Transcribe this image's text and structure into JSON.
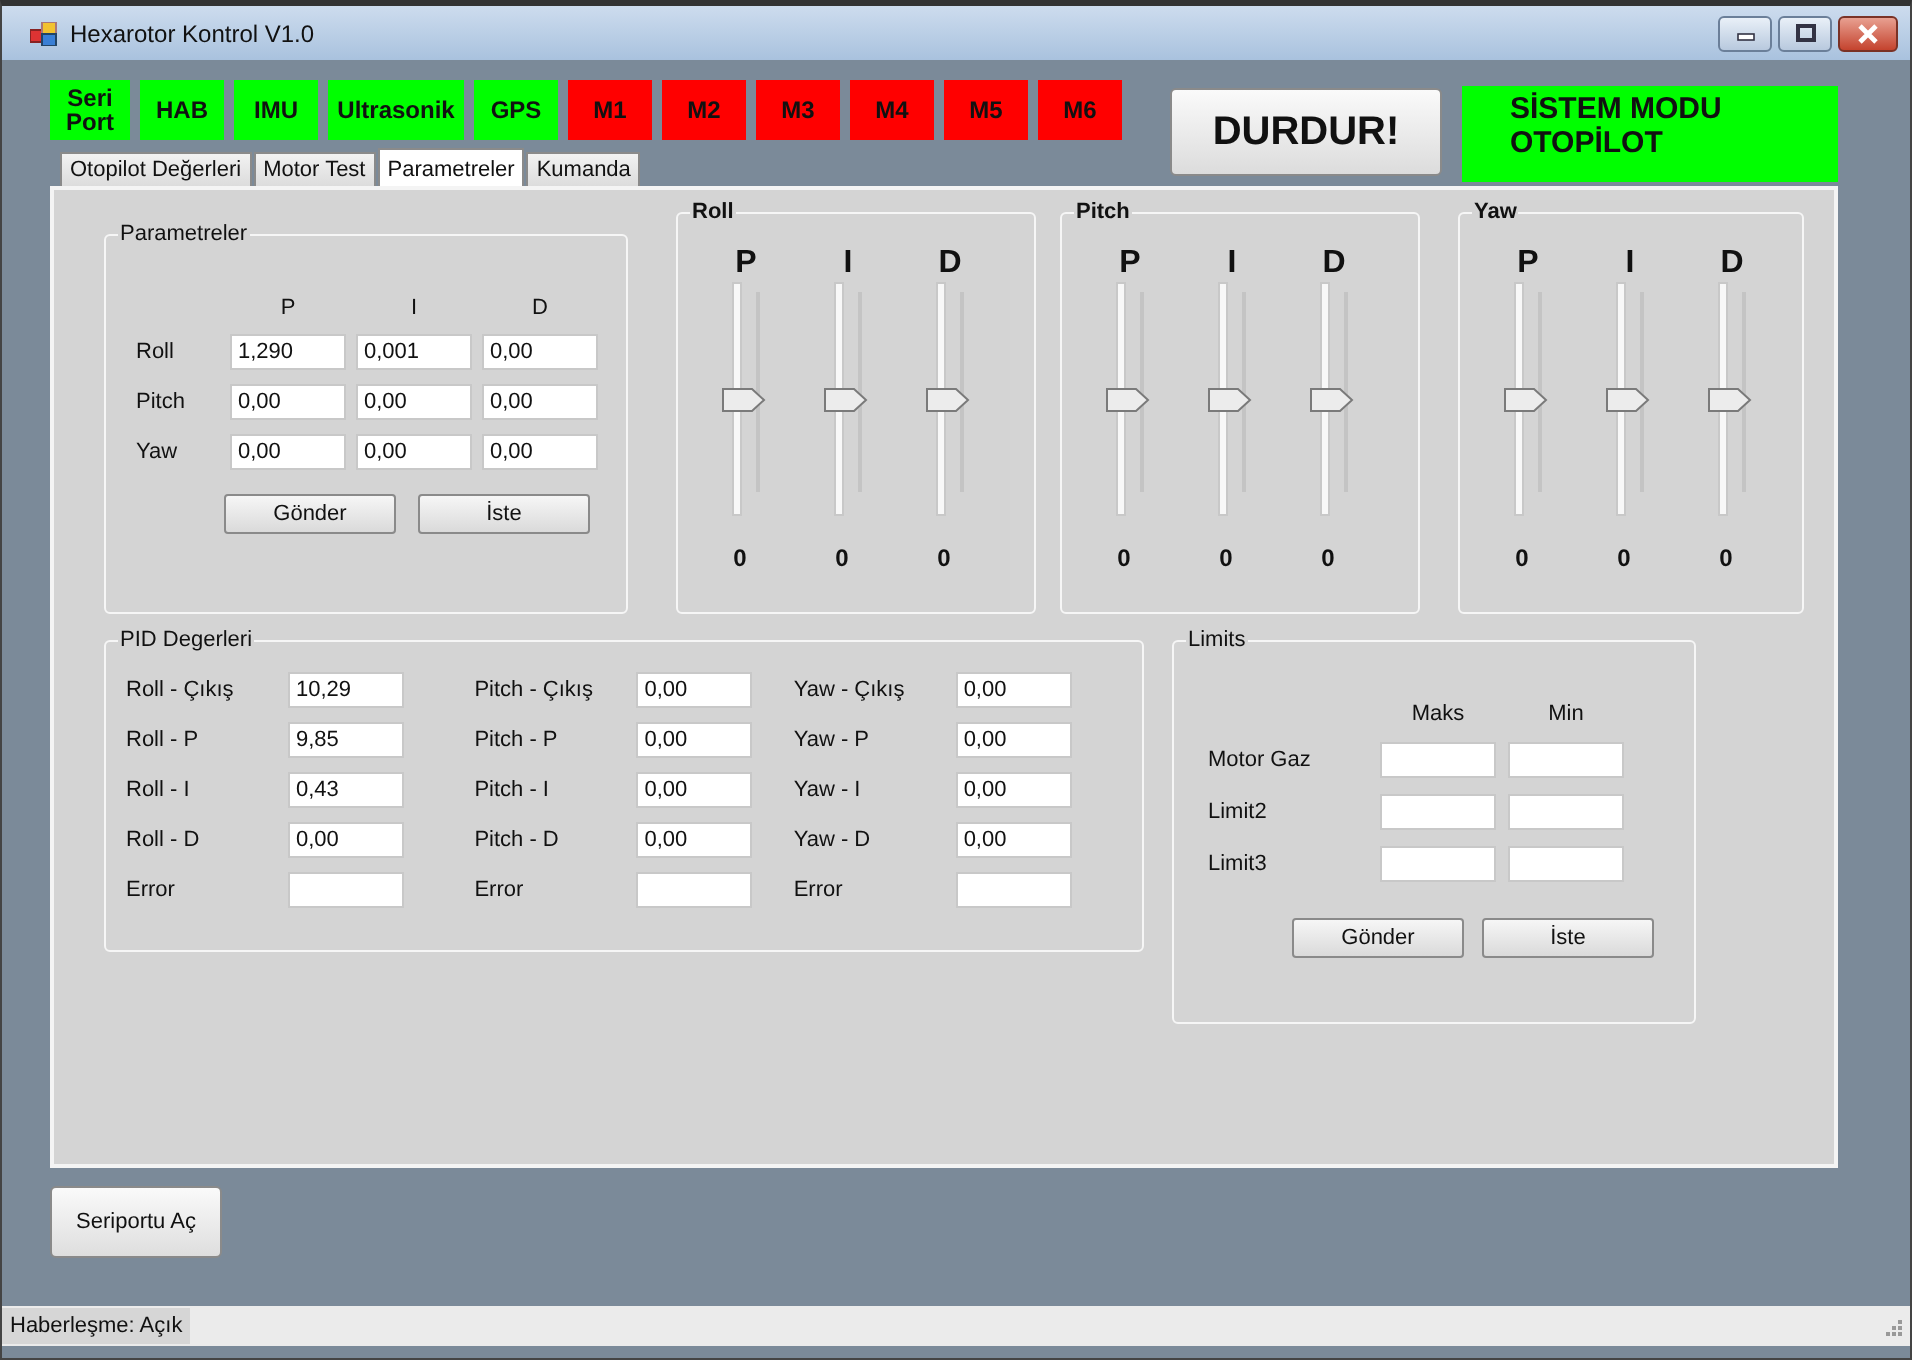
{
  "window": {
    "title": "Hexarotor Kontrol V1.0"
  },
  "indicators": [
    {
      "label": "Seri Port",
      "on": true
    },
    {
      "label": "HAB",
      "on": true
    },
    {
      "label": "IMU",
      "on": true
    },
    {
      "label": "Ultrasonik",
      "on": true
    },
    {
      "label": "GPS",
      "on": true
    },
    {
      "label": "M1",
      "on": false
    },
    {
      "label": "M2",
      "on": false
    },
    {
      "label": "M3",
      "on": false
    },
    {
      "label": "M4",
      "on": false
    },
    {
      "label": "M5",
      "on": false
    },
    {
      "label": "M6",
      "on": false
    }
  ],
  "stop_button": "DURDUR!",
  "mode_panel": "SİSTEM MODU OTOPİLOT",
  "tabs": [
    {
      "label": "Otopilot Değerleri",
      "selected": false
    },
    {
      "label": "Motor Test",
      "selected": false
    },
    {
      "label": "Parametreler",
      "selected": true
    },
    {
      "label": "Kumanda",
      "selected": false
    }
  ],
  "parameters": {
    "title": "Parametreler",
    "columns": [
      "P",
      "I",
      "D"
    ],
    "rows": [
      {
        "label": "Roll",
        "values": [
          "1,290",
          "0,001",
          "0,00"
        ]
      },
      {
        "label": "Pitch",
        "values": [
          "0,00",
          "0,00",
          "0,00"
        ]
      },
      {
        "label": "Yaw",
        "values": [
          "0,00",
          "0,00",
          "0,00"
        ]
      }
    ],
    "buttons": [
      "Gönder",
      "İste"
    ]
  },
  "slider_groups": [
    {
      "title": "Roll",
      "sliders": [
        {
          "label": "P",
          "level": 0.5,
          "reading": "0"
        },
        {
          "label": "I",
          "level": 0.5,
          "reading": "0"
        },
        {
          "label": "D",
          "level": 0.5,
          "reading": "0"
        }
      ]
    },
    {
      "title": "Pitch",
      "sliders": [
        {
          "label": "P",
          "level": 0.5,
          "reading": "0"
        },
        {
          "label": "I",
          "level": 0.5,
          "reading": "0"
        },
        {
          "label": "D",
          "level": 0.5,
          "reading": "0"
        }
      ]
    },
    {
      "title": "Yaw",
      "sliders": [
        {
          "label": "P",
          "level": 0.5,
          "reading": "0"
        },
        {
          "label": "I",
          "level": 0.5,
          "reading": "0"
        },
        {
          "label": "D",
          "level": 0.5,
          "reading": "0"
        }
      ]
    }
  ],
  "pid_values": {
    "title": "PID Degerleri",
    "columns": [
      {
        "rows": [
          {
            "label": "Roll - Çıkış",
            "value": "10,29"
          },
          {
            "label": "Roll - P",
            "value": "9,85"
          },
          {
            "label": "Roll - I",
            "value": "0,43"
          },
          {
            "label": "Roll - D",
            "value": "0,00"
          },
          {
            "label": "Error"
          }
        ]
      },
      {
        "rows": [
          {
            "label": "Pitch - Çıkış",
            "value": "0,00"
          },
          {
            "label": "Pitch - P",
            "value": "0,00"
          },
          {
            "label": "Pitch - I",
            "value": "0,00"
          },
          {
            "label": "Pitch - D",
            "value": "0,00"
          },
          {
            "label": "Error"
          }
        ]
      },
      {
        "rows": [
          {
            "label": "Yaw - Çıkış",
            "value": "0,00"
          },
          {
            "label": "Yaw - P",
            "value": "0,00"
          },
          {
            "label": "Yaw - I",
            "value": "0,00"
          },
          {
            "label": "Yaw - D",
            "value": "0,00"
          },
          {
            "label": "Error"
          }
        ]
      }
    ]
  },
  "limits": {
    "title": "Limits",
    "columns": [
      "Maks",
      "Min"
    ],
    "rows": [
      {
        "label": "Motor Gaz"
      },
      {
        "label": "Limit2"
      },
      {
        "label": "Limit3"
      }
    ],
    "buttons": [
      "Gönder",
      "İste"
    ]
  },
  "serial_button": "Seriportu Aç",
  "status_bar": "Haberleşme: Açık"
}
